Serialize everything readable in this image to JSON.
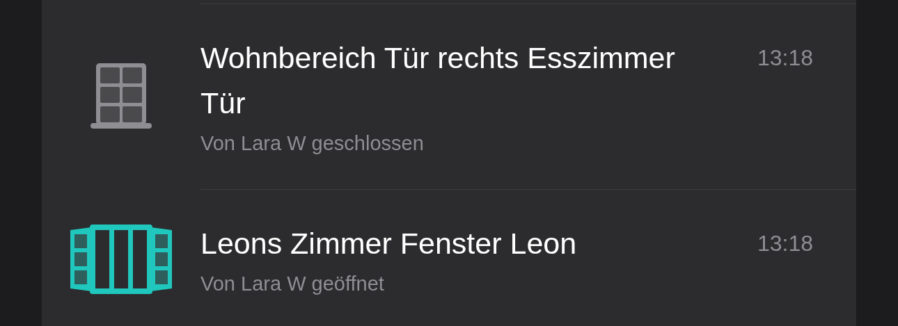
{
  "events": [
    {
      "title": "Wohnbereich Tür rechts Esszimmer Tür",
      "subtitle": "Von Lara W geschlossen",
      "time": "13:18",
      "open": false
    },
    {
      "title": "Leons Zimmer Fenster Leon",
      "subtitle": "Von Lara W geöffnet",
      "time": "13:18",
      "open": true
    }
  ]
}
